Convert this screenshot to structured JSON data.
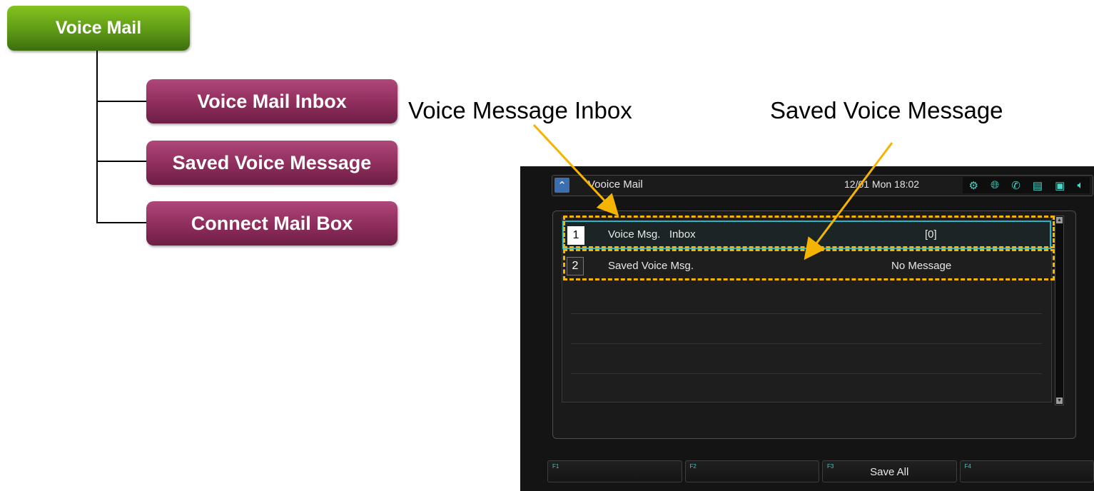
{
  "tree": {
    "root": "Voice Mail",
    "children": [
      "Voice Mail Inbox",
      "Saved Voice Message",
      "Connect Mail Box"
    ]
  },
  "callouts": {
    "inbox": "Voice Message Inbox",
    "saved": "Saved Voice Message"
  },
  "screen": {
    "title": "Vooice Mail",
    "datetime": "12/01 Mon 18:02",
    "status_icons": [
      "settings-icon",
      "globe-icon",
      "phone-icon",
      "calendar-icon",
      "video-icon",
      "speaker-icon"
    ],
    "rows": [
      {
        "num": "1",
        "label": "Voice Msg.   Inbox",
        "value": "[0]"
      },
      {
        "num": "2",
        "label": "Saved Voice Msg.",
        "value": "No Message"
      }
    ],
    "fkeys": [
      {
        "num": "F1",
        "label": ""
      },
      {
        "num": "F2",
        "label": ""
      },
      {
        "num": "F3",
        "label": "Save All"
      },
      {
        "num": "F4",
        "label": ""
      }
    ]
  },
  "colors": {
    "highlight": "#f5b400",
    "selection": "#26b6c8",
    "root_node": "#6aa51a",
    "child_node": "#8e2d5c"
  }
}
